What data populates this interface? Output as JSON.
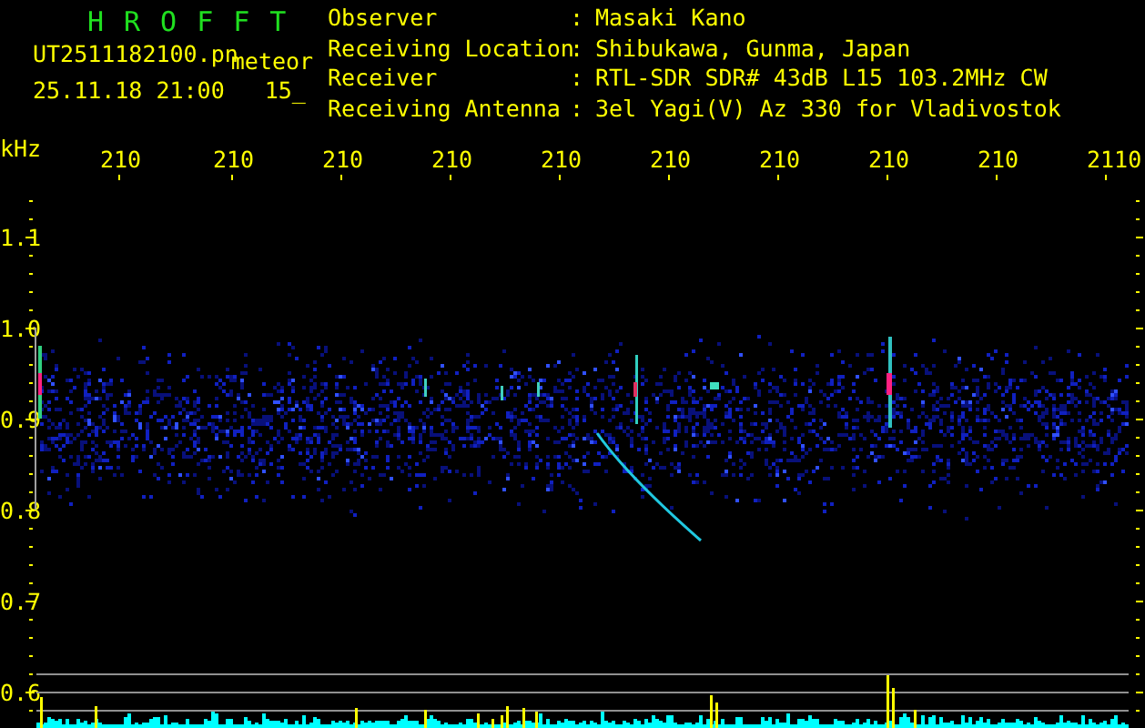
{
  "app_title": "HROFFT",
  "file_name": "UT2511182100.pn",
  "file_tag": "meteor",
  "timestamp": "25.11.18 21:00",
  "count": "15_",
  "station_info": [
    {
      "label": "Observer",
      "separator": ":",
      "value": "Masaki Kano"
    },
    {
      "label": "Receiving Location",
      "separator": ":",
      "value": "Shibukawa, Gunma, Japan"
    },
    {
      "label": "Receiver",
      "separator": ":",
      "value": "RTL-SDR SDR# 43dB L15 103.2MHz CW"
    },
    {
      "label": "Receiving Antenna",
      "separator": ":",
      "value": "3el Yagi(V) Az 330 for Vladivostok"
    }
  ],
  "y_unit": "kHz",
  "x_axis_labels": [
    "210",
    "210",
    "210",
    "210",
    "210",
    "210",
    "210",
    "210",
    "210",
    "2110"
  ],
  "y_axis_labels": [
    "1.1",
    "1.0",
    "0.9",
    "0.8",
    "0.7",
    "0.6"
  ]
}
